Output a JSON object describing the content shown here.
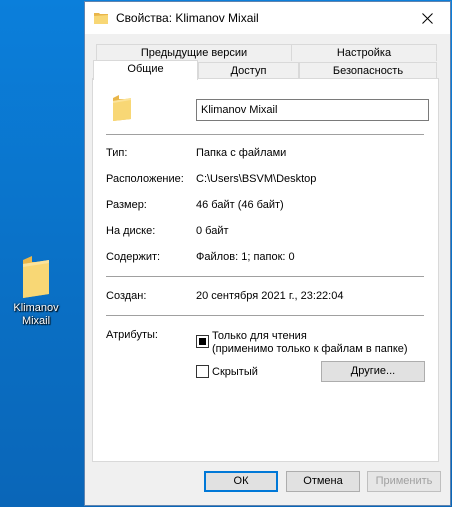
{
  "desktop": {
    "icon_label": "Klimanov Mixail"
  },
  "window": {
    "title": "Свойства: Klimanov Mixail",
    "tabs_top": [
      "Предыдущие версии",
      "Настройка"
    ],
    "tabs_bottom": [
      "Общие",
      "Доступ",
      "Безопасность"
    ],
    "active_tab": "Общие",
    "name_value": "Klimanov Mixail",
    "properties": [
      {
        "label": "Тип:",
        "value": "Папка с файлами"
      },
      {
        "label": "Расположение:",
        "value": "C:\\Users\\BSVM\\Desktop"
      },
      {
        "label": "Размер:",
        "value": "46 байт (46 байт)"
      },
      {
        "label": "На диске:",
        "value": "0 байт"
      },
      {
        "label": "Содержит:",
        "value": "Файлов: 1; папок: 0"
      }
    ],
    "created": {
      "label": "Создан:",
      "value": "20 сентября 2021 г., 23:22:04"
    },
    "attributes": {
      "label": "Атрибуты:",
      "readonly_line1": "Только для чтения",
      "readonly_line2": "(применимо только к файлам в папке)",
      "hidden_label": "Скрытый",
      "other_button": "Другие..."
    },
    "buttons": {
      "ok": "ОК",
      "cancel": "Отмена",
      "apply": "Применить"
    }
  },
  "colors": {
    "desktop": "#0a78d4",
    "folder": "#f8d775",
    "accent": "#0078d7"
  }
}
